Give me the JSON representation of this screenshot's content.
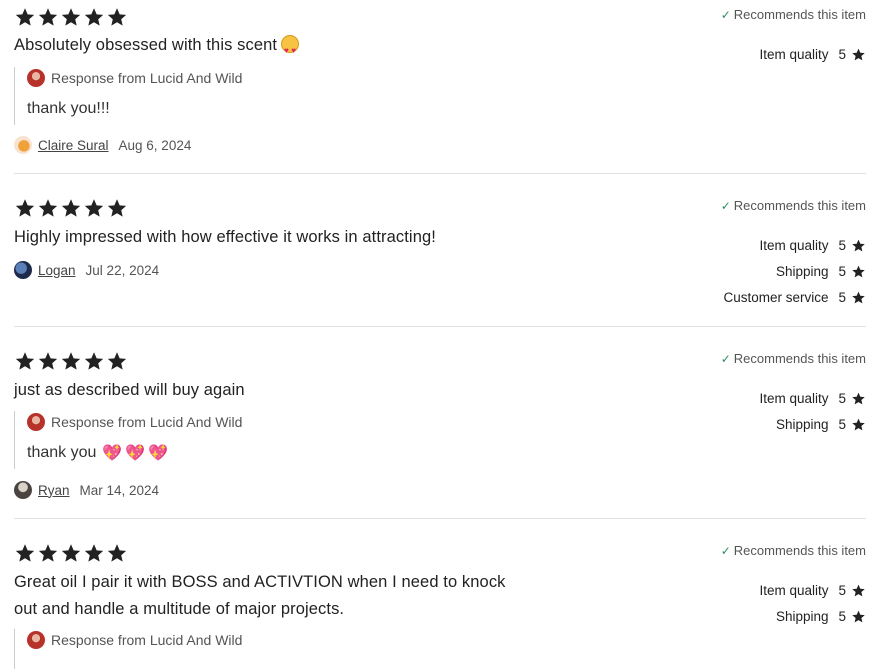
{
  "colors": {
    "star": "#222222",
    "check": "#2f8f5b",
    "divider": "#e1e1e1"
  },
  "reviews": [
    {
      "stars": 5,
      "text": "Absolutely obsessed with this scent",
      "emoji": "heart-eyes-emoji",
      "recommend": "Recommends this item",
      "ratings": [
        {
          "label": "Item quality",
          "value": "5"
        }
      ],
      "response": {
        "from": "Response from Lucid And Wild",
        "text": "thank you!!!"
      },
      "user": "Claire Sural",
      "date": "Aug 6, 2024"
    },
    {
      "stars": 5,
      "text": "Highly impressed with how effective it works in attracting!",
      "recommend": "Recommends this item",
      "ratings": [
        {
          "label": "Item quality",
          "value": "5"
        },
        {
          "label": "Shipping",
          "value": "5"
        },
        {
          "label": "Customer service",
          "value": "5"
        }
      ],
      "user": "Logan",
      "date": "Jul 22, 2024"
    },
    {
      "stars": 5,
      "text": "just as described will buy again",
      "recommend": "Recommends this item",
      "ratings": [
        {
          "label": "Item quality",
          "value": "5"
        },
        {
          "label": "Shipping",
          "value": "5"
        }
      ],
      "response": {
        "from": "Response from Lucid And Wild",
        "text": "thank you"
      },
      "user": "Ryan",
      "date": "Mar 14, 2024"
    },
    {
      "stars": 5,
      "text_line1": "Great oil I pair it with BOSS and ACTIVTION when I need to knock",
      "text_line2": "out and handle a multitude of major projects.",
      "recommend": "Recommends this item",
      "ratings": [
        {
          "label": "Item quality",
          "value": "5"
        },
        {
          "label": "Shipping",
          "value": "5"
        }
      ],
      "response": {
        "from": "Response from Lucid And Wild"
      }
    }
  ]
}
